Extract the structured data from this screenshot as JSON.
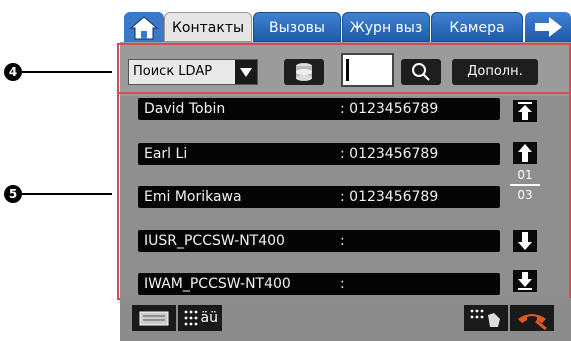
{
  "tabs": {
    "home": "",
    "items": [
      {
        "label": "Контакты",
        "active": true
      },
      {
        "label": "Вызовы"
      },
      {
        "label": "Журн выз"
      },
      {
        "label": "Камера"
      }
    ]
  },
  "toolbar": {
    "ldap_select": "Поиск LDAP",
    "search_value": "",
    "more_label": "Дополн."
  },
  "contacts": [
    {
      "name": "David Tobin",
      "phone": ": 0123456789"
    },
    {
      "name": "Earl Li",
      "phone": ": 0123456789"
    },
    {
      "name": "Emi Morikawa",
      "phone": ": 0123456789"
    },
    {
      "name": "IUSR_PCCSW-NT400",
      "phone": ":"
    },
    {
      "name": "IWAM_PCCSW-NT400",
      "phone": ":"
    }
  ],
  "pager": {
    "current": "01",
    "total": "03"
  },
  "bottom": {
    "keyboard2_label": "äü"
  },
  "annotations": {
    "callout4": "4",
    "callout5": "5"
  },
  "colors": {
    "tab_blue": "#2f6fc0",
    "callout_red": "#d84a5a"
  }
}
